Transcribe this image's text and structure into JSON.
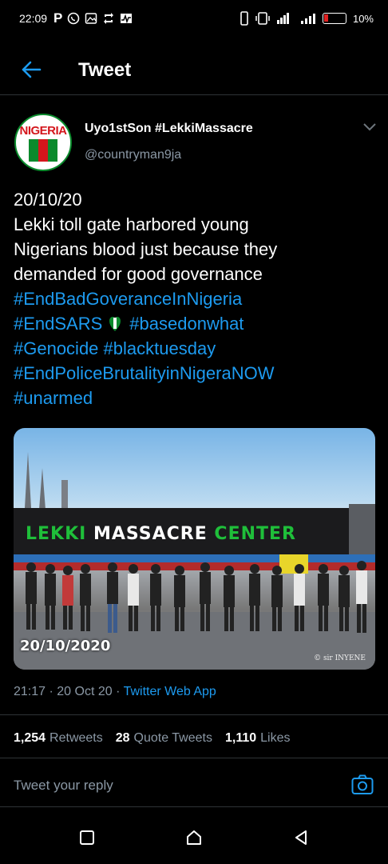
{
  "status_bar": {
    "time": "22:09",
    "app_glyph": "P",
    "battery_level": "10%",
    "icons": [
      "whatsapp-icon",
      "gallery-icon",
      "sync-icon",
      "activity-icon",
      "vibrate-icon",
      "wifi-icon",
      "signal-icon",
      "battery-icon"
    ]
  },
  "header": {
    "title": "Tweet"
  },
  "author": {
    "display_name": "Uyo1stSon #LekkiMassacre",
    "handle": "@countryman9ja",
    "avatar_text": "NIGERIA"
  },
  "tweet": {
    "lines": [
      "20/10/20",
      "Lekki toll gate harbored young",
      "Nigerians blood just because they",
      "demanded for good governance"
    ],
    "hashtags": [
      "#EndBadGoveranceInNigeria",
      "#EndSARS",
      "#basedonwhat",
      "#Genocide",
      "#blacktuesday",
      "#EndPoliceBrutalityinNigeraNOW",
      "#unarmed"
    ]
  },
  "media": {
    "banner_text_parts": [
      "LEKKI ",
      "MASSACRE",
      " CENTER"
    ],
    "date_overlay": "20/10/2020",
    "credit": "© sir INYENE"
  },
  "meta": {
    "time": "21:17",
    "date": "20 Oct 20",
    "source": "Twitter Web App"
  },
  "stats": {
    "retweets_count": "1,254",
    "retweets_label": "Retweets",
    "quotes_count": "28",
    "quotes_label": "Quote Tweets",
    "likes_count": "1,110",
    "likes_label": "Likes"
  },
  "reply": {
    "placeholder": "Tweet your reply"
  },
  "colors": {
    "accent": "#1d9bf0",
    "secondary_text": "#8b98a5",
    "divider": "#2f3336",
    "background": "#000000"
  }
}
